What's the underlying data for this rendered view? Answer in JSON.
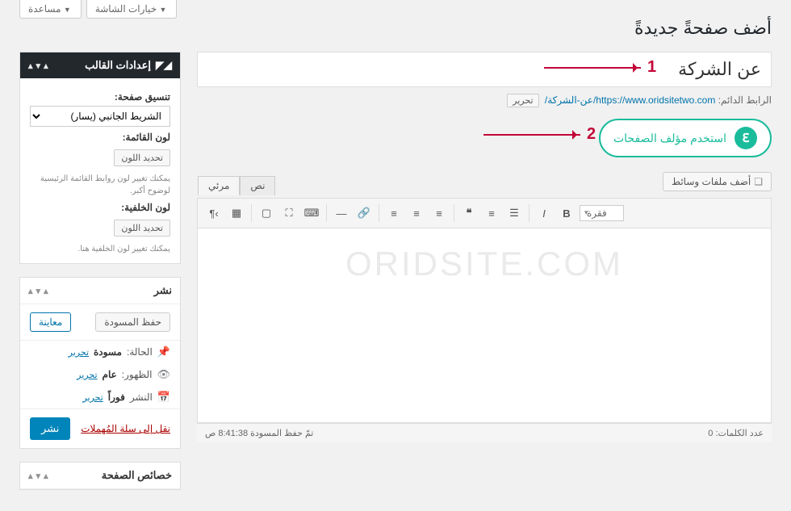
{
  "topTabs": {
    "screenOptions": "خيارات الشاشة",
    "help": "مساعدة"
  },
  "pageHeading": "أضف صفحةً جديدةً",
  "titleValue": "عن الشركة",
  "permalink": {
    "label": "الرابط الدائم:",
    "base": "https://www.oridsitetwo.com",
    "slug": "/عن-الشركة/",
    "editBtn": "تحرير"
  },
  "composerBtn": "استخدم مؤلف الصفحات",
  "mediaBtn": "أضف ملفات وسائط",
  "edTabs": {
    "visual": "مرئي",
    "text": "نص"
  },
  "paragraphSel": "فقرة",
  "watermark": "ORIDSITE.COM",
  "statusBar": {
    "words": "عدد الكلمات: 0",
    "saved": "تمّ حفظ المسودة 8:41:38 ص"
  },
  "settingsBox": {
    "title": "إعدادات القالب",
    "layoutLabel": "تنسيق صفحة:",
    "layoutSel": "الشريط الجانبي (يسار)",
    "menuColorLabel": "لون القائمة:",
    "colorBtn": "تحديد اللون",
    "menuHint": "يمكنك تغيير لون روابط القائمة الرئيسية لوضوح أكبر.",
    "bgColorLabel": "لون الخلفية:",
    "bgHint": "يمكنك تغيير لون الخلفية هنا."
  },
  "publishBox": {
    "title": "نشر",
    "saveDraft": "حفظ المسودة",
    "preview": "معاينة",
    "statusLabel": "الحالة:",
    "statusVal": "مسودة",
    "statusEdit": "تحرير",
    "visLabel": "الظهور:",
    "visVal": "عام",
    "visEdit": "تحرير",
    "schedLabel": "النشر",
    "schedVal": "فوراً",
    "schedEdit": "تحرير",
    "trash": "نقل إلى سلة المُهملات",
    "publish": "نشر"
  },
  "attribsBox": {
    "title": "خصائص الصفحة"
  },
  "annot": {
    "one": "1",
    "two": "2"
  }
}
